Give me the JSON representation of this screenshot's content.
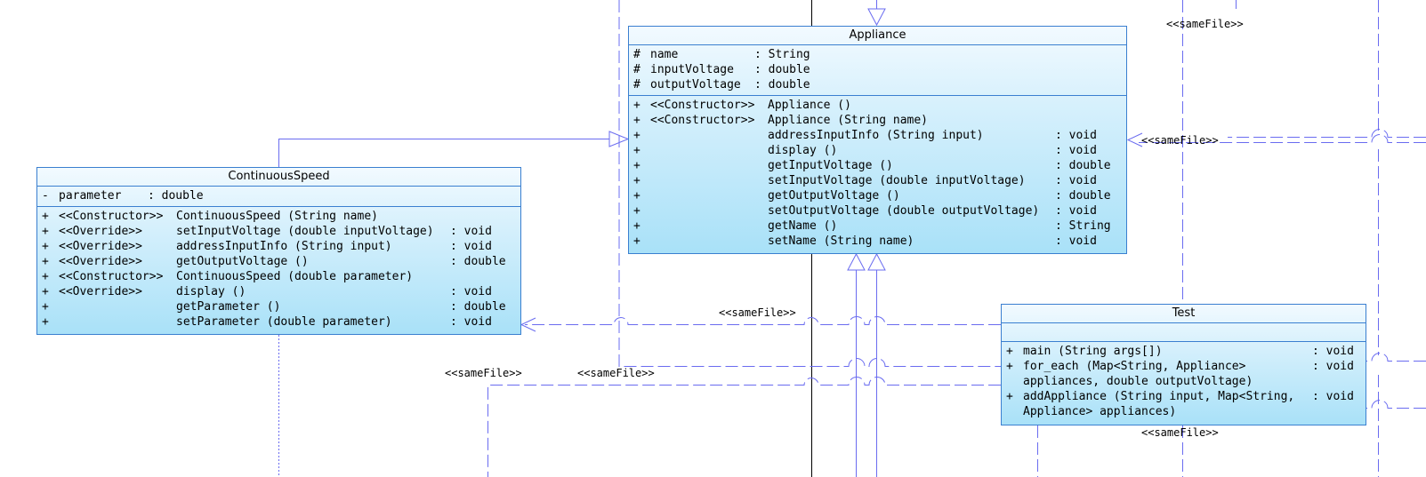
{
  "same_file_label": "<<sameFile>>",
  "appliance": {
    "name": "Appliance",
    "attributes": [
      {
        "vis": "#",
        "name": "name",
        "type": ": String"
      },
      {
        "vis": "#",
        "name": "inputVoltage",
        "type": ": double"
      },
      {
        "vis": "#",
        "name": "outputVoltage",
        "type": ": double"
      }
    ],
    "operations": [
      {
        "vis": "+",
        "stereo": "<<Constructor>>",
        "sig": "Appliance ()",
        "ret": ""
      },
      {
        "vis": "+",
        "stereo": "<<Constructor>>",
        "sig": "Appliance (String name)",
        "ret": ""
      },
      {
        "vis": "+",
        "stereo": "",
        "sig": "addressInputInfo (String input)",
        "ret": ": void"
      },
      {
        "vis": "+",
        "stereo": "",
        "sig": "display ()",
        "ret": ": void"
      },
      {
        "vis": "+",
        "stereo": "",
        "sig": "getInputVoltage ()",
        "ret": ": double"
      },
      {
        "vis": "+",
        "stereo": "",
        "sig": "setInputVoltage (double inputVoltage)",
        "ret": ": void"
      },
      {
        "vis": "+",
        "stereo": "",
        "sig": "getOutputVoltage ()",
        "ret": ": double"
      },
      {
        "vis": "+",
        "stereo": "",
        "sig": "setOutputVoltage (double outputVoltage)",
        "ret": ": void"
      },
      {
        "vis": "+",
        "stereo": "",
        "sig": "getName ()",
        "ret": ": String"
      },
      {
        "vis": "+",
        "stereo": "",
        "sig": "setName (String name)",
        "ret": ": void"
      }
    ]
  },
  "continuous_speed": {
    "name": "ContinuousSpeed",
    "attributes": [
      {
        "vis": "-",
        "name": "parameter",
        "type": ": double"
      }
    ],
    "operations": [
      {
        "vis": "+",
        "stereo": "<<Constructor>>",
        "sig": "ContinuousSpeed (String name)",
        "ret": ""
      },
      {
        "vis": "+",
        "stereo": "<<Override>>",
        "sig": "setInputVoltage (double inputVoltage)",
        "ret": ": void"
      },
      {
        "vis": "+",
        "stereo": "<<Override>>",
        "sig": "addressInputInfo (String input)",
        "ret": ": void"
      },
      {
        "vis": "+",
        "stereo": "<<Override>>",
        "sig": "getOutputVoltage ()",
        "ret": ": double"
      },
      {
        "vis": "+",
        "stereo": "<<Constructor>>",
        "sig": "ContinuousSpeed (double parameter)",
        "ret": ""
      },
      {
        "vis": "+",
        "stereo": "<<Override>>",
        "sig": "display ()",
        "ret": ": void"
      },
      {
        "vis": "+",
        "stereo": "",
        "sig": "getParameter ()",
        "ret": ": double"
      },
      {
        "vis": "+",
        "stereo": "",
        "sig": "setParameter (double parameter)",
        "ret": ": void"
      }
    ]
  },
  "test": {
    "name": "Test",
    "operations": [
      {
        "vis": "+",
        "sig": "main (String args[])",
        "ret": ": void"
      },
      {
        "vis": "+",
        "sig": "for_each (Map<String, Appliance>\n  appliances, double outputVoltage)",
        "ret": ": void"
      },
      {
        "vis": "+",
        "sig": "addAppliance (String input, Map<String,\n  Appliance> appliances)",
        "ret": ": void"
      }
    ]
  }
}
